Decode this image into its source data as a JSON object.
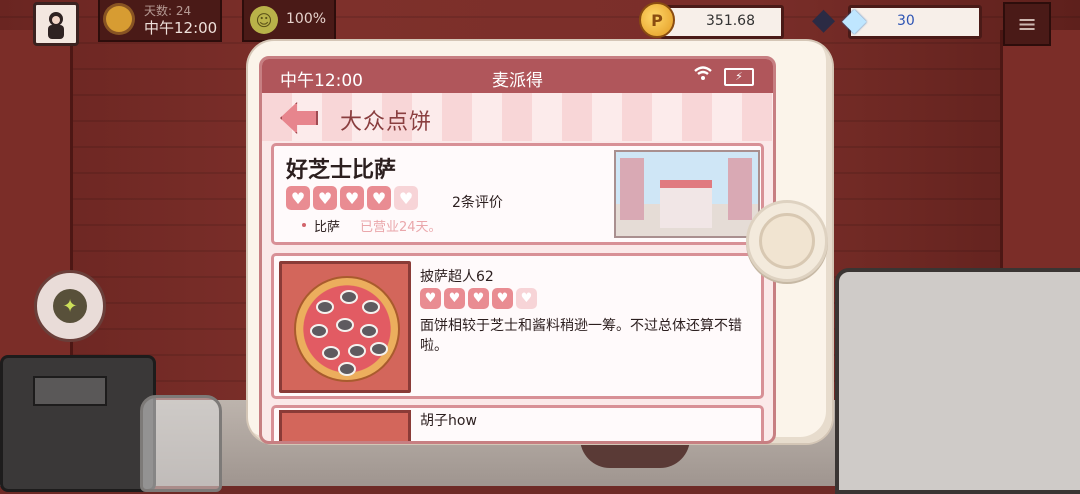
{
  "hud": {
    "day_label": "天数: 24",
    "day_time": "中午12:00",
    "mood_percent": "100%",
    "coins": "351.68",
    "coin_symbol": "P",
    "gems": "30"
  },
  "phone": {
    "status_time": "中午12:00",
    "app_name": "麦派得",
    "section_title": "大众点饼",
    "pizzeria": {
      "name": "好芝士比萨",
      "rating": 4,
      "max_rating": 5,
      "review_count": "2条评价",
      "category": "比萨",
      "days_open": "已营业24天。"
    },
    "reviews": [
      {
        "author": "披萨超人62",
        "rating": 4,
        "max_rating": 5,
        "text": "面饼相较于芝士和酱料稍逊一筹。不过总体还算不错啦。"
      },
      {
        "author": "胡子how"
      }
    ]
  },
  "colors": {
    "accent": "#b0565b",
    "heart_full": "#e98c92",
    "heart_empty": "#f7d4d7",
    "card_border": "#d89096"
  }
}
